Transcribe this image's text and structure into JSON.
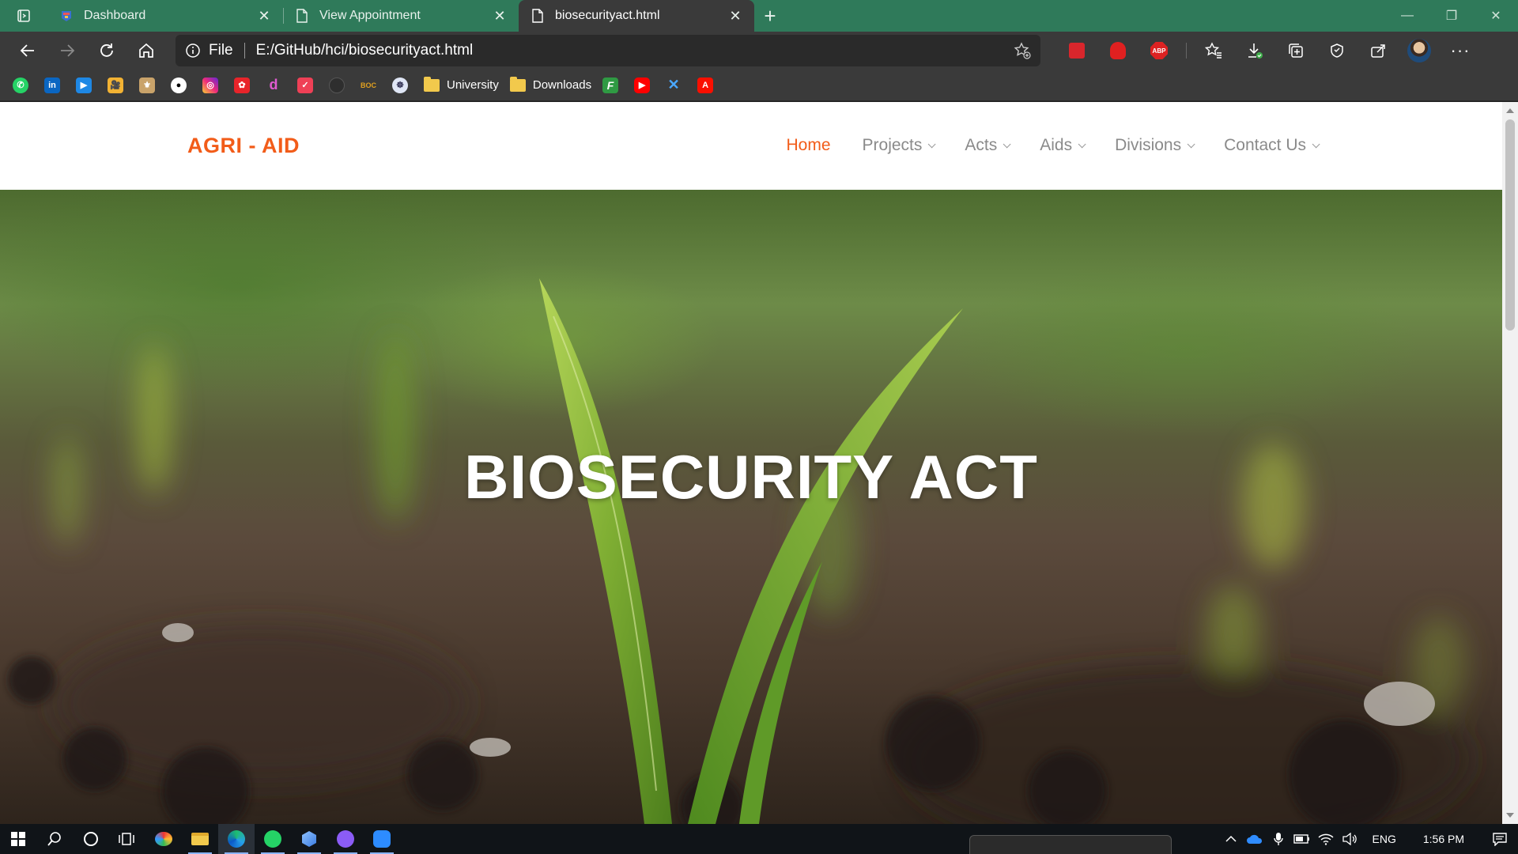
{
  "browser": {
    "tabs": [
      {
        "title": "Dashboard",
        "active": false
      },
      {
        "title": "View Appointment",
        "active": false
      },
      {
        "title": "biosecurityact.html",
        "active": true
      }
    ],
    "address": {
      "scheme_label": "File",
      "url": "E:/GitHub/hci/biosecurityact.html"
    },
    "bookmarks": [
      {
        "label": "University",
        "type": "folder"
      },
      {
        "label": "Downloads",
        "type": "folder"
      }
    ]
  },
  "site": {
    "brand": "AGRI - AID",
    "nav": [
      {
        "label": "Home",
        "active": true,
        "dropdown": false
      },
      {
        "label": "Projects",
        "active": false,
        "dropdown": true
      },
      {
        "label": "Acts",
        "active": false,
        "dropdown": true
      },
      {
        "label": "Aids",
        "active": false,
        "dropdown": true
      },
      {
        "label": "Divisions",
        "active": false,
        "dropdown": true
      },
      {
        "label": "Contact Us",
        "active": false,
        "dropdown": true
      }
    ],
    "hero_title": "BIOSECURITY ACT",
    "accent_color": "#f25c19"
  },
  "taskbar": {
    "language": "ENG",
    "time": "1:56 PM"
  },
  "colors": {
    "tabstrip": "#2f7a5a",
    "toolbar": "#3a3a3a"
  }
}
